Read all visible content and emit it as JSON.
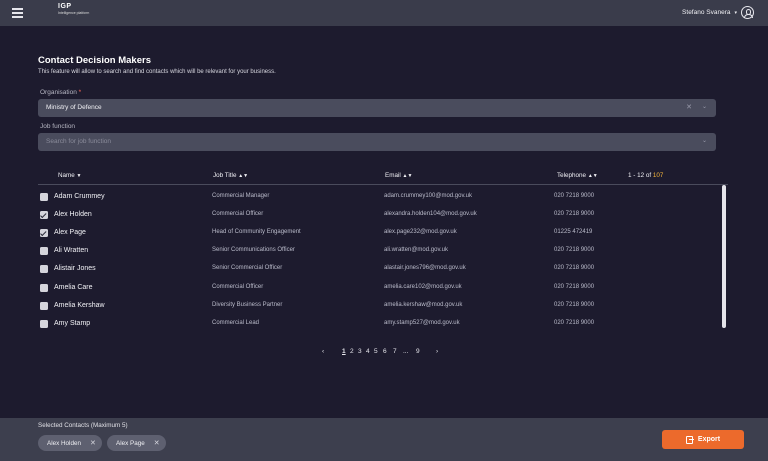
{
  "app": {
    "logo_line1": "IGP",
    "logo_line2": "Intelligence platform",
    "user_name": "Stefano Svanera"
  },
  "page": {
    "title": "Contact Decision Makers",
    "description": "This feature will allow to search and find contacts which will be relevant for your business."
  },
  "filters": {
    "organisation_label": "Organisation",
    "organisation_required": "*",
    "organisation_value": "Ministry of Defence",
    "job_function_label": "Job function",
    "job_function_placeholder": "Search for job function"
  },
  "table": {
    "headers": {
      "name": "Name",
      "job_title": "Job Title",
      "email": "Email",
      "telephone": "Telephone"
    },
    "range_text": "1 - 12 of",
    "total": "107",
    "rows": [
      {
        "checked": false,
        "name": "Adam Crummey",
        "job": "Commercial Manager",
        "email": "adam.crummey100@mod.gov.uk",
        "tel": "020 7218 9000"
      },
      {
        "checked": true,
        "name": "Alex Holden",
        "job": "Commercial Officer",
        "email": "alexandra.holden104@mod.gov.uk",
        "tel": "020 7218 9000"
      },
      {
        "checked": true,
        "name": "Alex Page",
        "job": "Head of Community Engagement",
        "email": "alex.page232@mod.gov.uk",
        "tel": "01225 472419"
      },
      {
        "checked": false,
        "name": "Ali Wratten",
        "job": "Senior Communications Officer",
        "email": "ali.wratten@mod.gov.uk",
        "tel": "020 7218 9000"
      },
      {
        "checked": false,
        "name": "Alistair Jones",
        "job": "Senior Commercial Officer",
        "email": "alastair.jones796@mod.gov.uk",
        "tel": "020 7218 9000"
      },
      {
        "checked": false,
        "name": "Amelia Care",
        "job": "Commercial Officer",
        "email": "amelia.care102@mod.gov.uk",
        "tel": "020 7218 9000"
      },
      {
        "checked": false,
        "name": "Amelia Kershaw",
        "job": "Diversity Business Partner",
        "email": "amelia.kershaw@mod.gov.uk",
        "tel": "020 7218 9000"
      },
      {
        "checked": false,
        "name": "Amy Stamp",
        "job": "Commercial Lead",
        "email": "amy.stamp527@mod.gov.uk",
        "tel": "020 7218 9000"
      }
    ]
  },
  "pagination": {
    "prev": "‹",
    "pages": [
      "1",
      "2",
      "3",
      "4",
      "5",
      "6",
      "7",
      "...",
      "9"
    ],
    "active": "1",
    "next": "›"
  },
  "footer": {
    "selected_label": "Selected Contacts (Maximum 5)",
    "chips": [
      "Alex Holden",
      "Alex Page"
    ],
    "export_label": "Export"
  },
  "colors": {
    "background": "#1d1b2e",
    "topbar": "#3a3c4b",
    "accent": "#ec6a2c",
    "total_highlight": "#f5b53a"
  }
}
